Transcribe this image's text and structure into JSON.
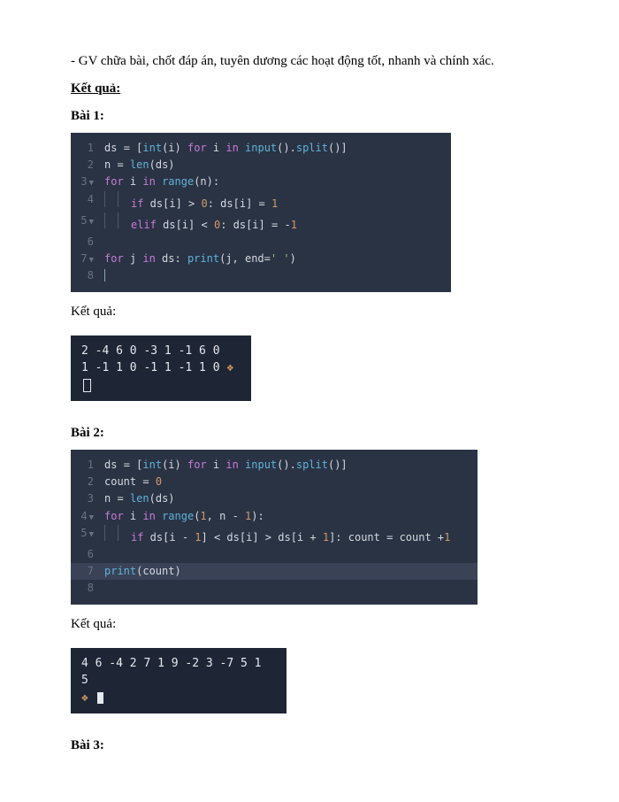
{
  "intro": "- GV chữa bài, chốt đáp án, tuyên dương các hoạt động tốt, nhanh và chính xác.",
  "heading_results": "Kết quả:",
  "result_label": "Kết quả:",
  "bai1": {
    "title": "Bài 1:",
    "code": {
      "l1": "ds = [int(i) for i in input().split()]",
      "l2": "n = len(ds)",
      "l3": "for i in range(n):",
      "l4": "if ds[i] > 0: ds[i] = 1",
      "l5": "elif ds[i] < 0: ds[i] = -1",
      "l6": "",
      "l7": "for j in ds: print(j, end=' ')",
      "l8": ""
    },
    "output": {
      "line1": "2 -4 6 0 -3 1 -1 6 0",
      "line2": "1 -1 1 0 -1 1 -1 1 0"
    }
  },
  "bai2": {
    "title": "Bài 2:",
    "code": {
      "l1": "ds = [int(i) for i in input().split()]",
      "l2": "count = 0",
      "l3": "n = len(ds)",
      "l4": "for i in range(1, n - 1):",
      "l5": "if ds[i - 1] < ds[i] > ds[i + 1]: count = count +1",
      "l6": "",
      "l7": "print(count)",
      "l8": ""
    },
    "output": {
      "line1": "4 6 -4 2 7 1 9 -2 3 -7 5 1",
      "line2": "5"
    }
  },
  "bai3": {
    "title": "Bài 3:"
  }
}
